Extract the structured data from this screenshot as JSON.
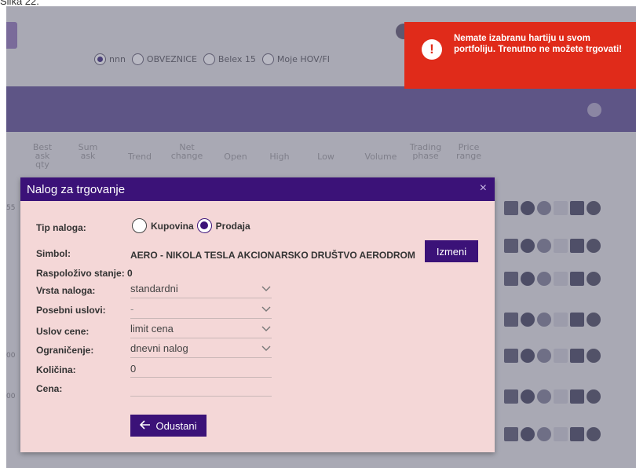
{
  "caption": "Slika 22.",
  "background": {
    "radio_options": [
      {
        "label": "nnn",
        "selected": true
      },
      {
        "label": "OBVEZNICE",
        "selected": false
      },
      {
        "label": "Belex 15",
        "selected": false
      },
      {
        "label": "Moje HOV/FI",
        "selected": false
      }
    ],
    "columns": [
      "Best ask qty",
      "Sum ask",
      "Trend",
      "Net change",
      "Open",
      "High",
      "Low",
      "Volume",
      "Trading phase",
      "Price range"
    ],
    "row_labels": [
      "55",
      "",
      "",
      "",
      "00",
      "00",
      ""
    ]
  },
  "modal": {
    "title": "Nalog za trgovanje",
    "close_symbol": "×",
    "order_type_label": "Tip naloga:",
    "order_type_options": [
      {
        "label": "Kupovina",
        "selected": false
      },
      {
        "label": "Prodaja",
        "selected": true
      }
    ],
    "symbol_label": "Simbol:",
    "symbol_value": "AERO - NIKOLA TESLA AKCIONARSKO DRUŠTVO AERODROM",
    "change_button": "Izmeni",
    "available_label": "Raspoloživo stanje: 0",
    "order_kind_label": "Vrsta naloga:",
    "order_kind_value": "standardni",
    "special_label": "Posebni uslovi:",
    "special_value": "-",
    "price_cond_label": "Uslov cene:",
    "price_cond_value": "limit cena",
    "limit_label": "Ograničenje:",
    "limit_value": "dnevni nalog",
    "quantity_label": "Količina:",
    "quantity_value": "0",
    "price_label": "Cena:",
    "price_value": "",
    "cancel_button": "Odustani",
    "cancel_icon": "arrow-left-icon"
  },
  "toast": {
    "icon": "exclamation-icon",
    "message": "Nemate izabranu hartiju u svom portfoliju. Trenutno ne možete trgovati!",
    "color": "#e02b1a"
  },
  "colors": {
    "primary": "#3b1278",
    "modal_bg": "#f4d7d7",
    "overlay": "#a9a9b4"
  }
}
